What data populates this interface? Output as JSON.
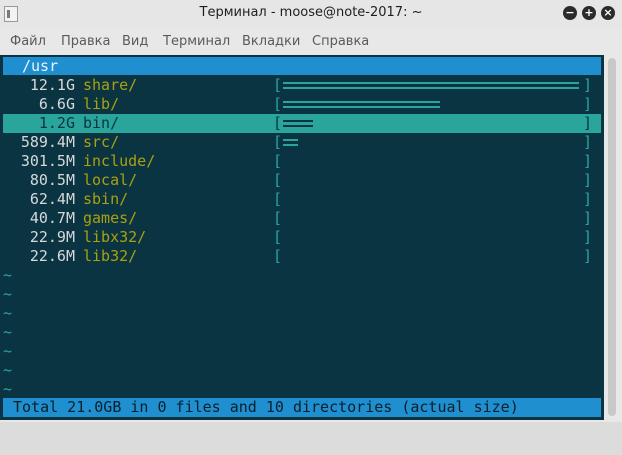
{
  "window": {
    "title": "Терминал - moose@note-2017: ~",
    "buttons": {
      "minimize": "−",
      "maximize": "+",
      "close": "×"
    }
  },
  "menu": [
    "Файл",
    "Правка",
    "Вид",
    "Терминал",
    "Вкладки",
    "Справка"
  ],
  "ncdu": {
    "path": "/usr",
    "selected_index": 2,
    "entries": [
      {
        "size": "12.1G",
        "name": "share/",
        "ratio": 1.0
      },
      {
        "size": "6.6G",
        "name": "lib/",
        "ratio": 0.53
      },
      {
        "size": "1.2G",
        "name": "bin/",
        "ratio": 0.1
      },
      {
        "size": "589.4M",
        "name": "src/",
        "ratio": 0.05
      },
      {
        "size": "301.5M",
        "name": "include/",
        "ratio": 0
      },
      {
        "size": "80.5M",
        "name": "local/",
        "ratio": 0
      },
      {
        "size": "62.4M",
        "name": "sbin/",
        "ratio": 0
      },
      {
        "size": "40.7M",
        "name": "games/",
        "ratio": 0
      },
      {
        "size": "22.9M",
        "name": "libx32/",
        "ratio": 0
      },
      {
        "size": "22.6M",
        "name": "lib32/",
        "ratio": 0
      }
    ],
    "gauge_open": "[",
    "gauge_close": "]",
    "empty_marker": "~",
    "status": "Total 21.0GB in 0 files and 10 directories (actual size)"
  },
  "colors": {
    "terminal_bg": "#0b3443",
    "highlight": "#2aa59b",
    "header": "#1f8fd0",
    "dir_name": "#a9a10f"
  }
}
